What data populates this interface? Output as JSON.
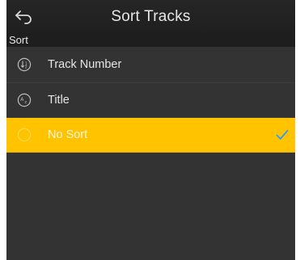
{
  "header": {
    "title": "Sort Tracks",
    "back_icon": "back-arrow-icon"
  },
  "section": {
    "label": "Sort"
  },
  "sort_options": [
    {
      "label": "Track Number",
      "icon": "sort-number-icon",
      "selected": false
    },
    {
      "label": "Title",
      "icon": "sort-alpha-icon",
      "selected": false
    },
    {
      "label": "No Sort",
      "icon": "no-sort-icon",
      "selected": true
    }
  ],
  "colors": {
    "selected_row": "#ffc300",
    "check_mark": "#2f9bff",
    "background": "#333333",
    "header": "#222222"
  }
}
